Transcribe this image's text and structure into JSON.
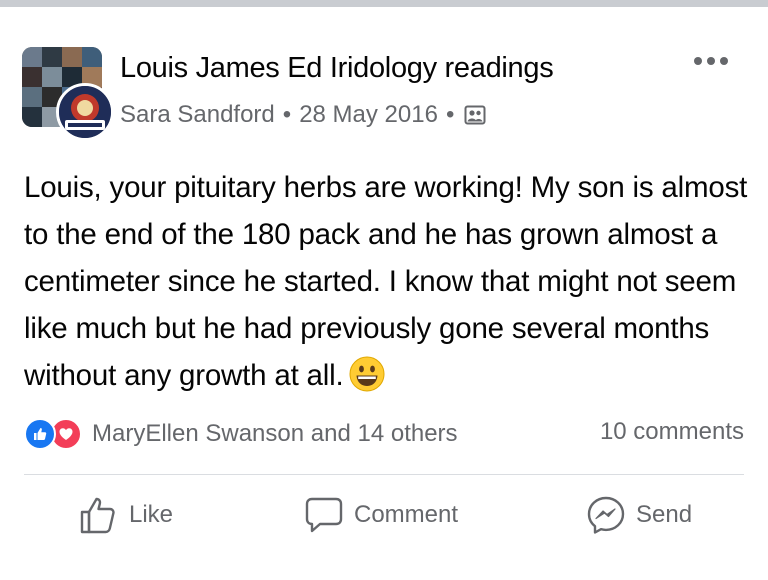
{
  "post": {
    "group_name": "Louis James Ed Iridology readings",
    "author": "Sara Sandford",
    "separator": "•",
    "date": "28 May 2016",
    "audience_icon": "group-members-icon",
    "body": "Louis, your pituitary herbs are working!  My son is almost to the end of the 180 pack and he has grown almost a centimeter since he started.  I know that might not seem like much but he had previously gone several months without any growth at all.",
    "body_emoji": "grinning-face-emoji"
  },
  "reactions": {
    "icons": [
      "like-reaction-icon",
      "love-reaction-icon"
    ],
    "summary": "MaryEllen Swanson and 14 others",
    "comments": "10 comments"
  },
  "actions": {
    "like": "Like",
    "comment": "Comment",
    "send": "Send"
  },
  "colors": {
    "text_primary": "#050505",
    "text_secondary": "#65676b",
    "like_blue": "#1877f2",
    "love_red": "#f33e58",
    "divider": "#dadde1"
  }
}
